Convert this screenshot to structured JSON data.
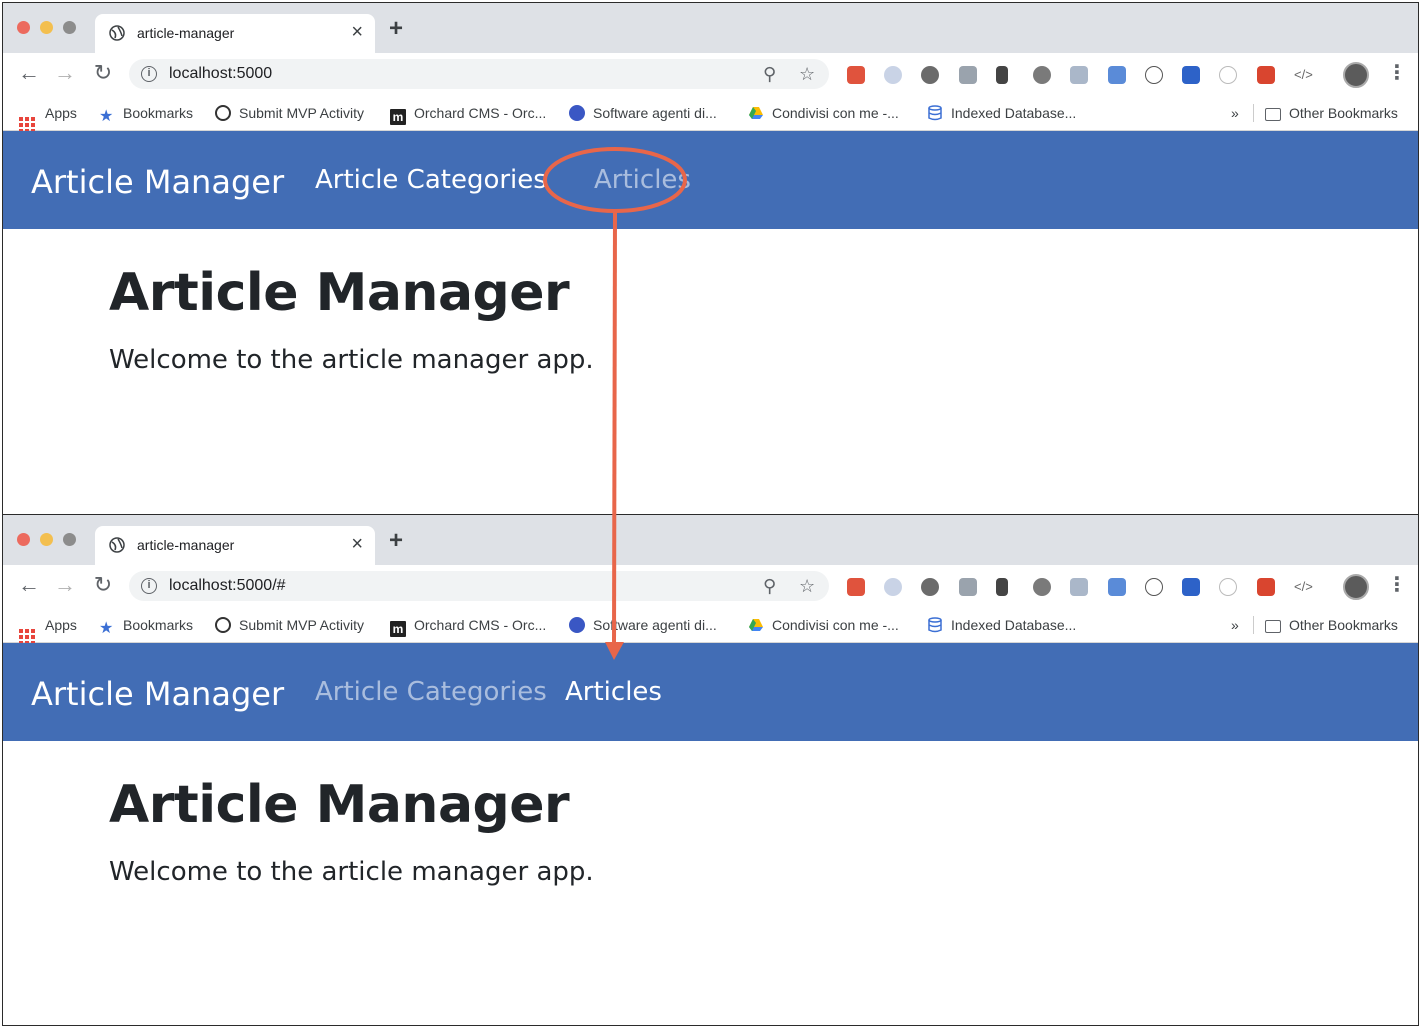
{
  "colors": {
    "navbar": "#426db5",
    "annotation": "#e8664a",
    "text_dark": "#212529",
    "chrome_tabstrip": "#dee1e6"
  },
  "bookmarks": [
    {
      "label": "Apps",
      "icon": "apps-grid-icon"
    },
    {
      "label": "Bookmarks",
      "icon": "star-icon"
    },
    {
      "label": "Submit MVP Activity",
      "icon": "globe-icon"
    },
    {
      "label": "Orchard CMS - Orc...",
      "icon": "orchard-m-icon"
    },
    {
      "label": "Software agenti di...",
      "icon": "agent-icon"
    },
    {
      "label": "Condivisi con me -...",
      "icon": "drive-icon"
    },
    {
      "label": "Indexed Database...",
      "icon": "database-icon"
    }
  ],
  "overflow_label": "»",
  "other_bookmarks": "Other Bookmarks",
  "windows": [
    {
      "tab_title": "article-manager",
      "tab_close": "×",
      "new_tab": "+",
      "url": "localhost:5000",
      "app": {
        "brand": "Article Manager",
        "nav": [
          {
            "label": "Article Categories",
            "active": true
          },
          {
            "label": "Articles",
            "active": false
          }
        ],
        "heading": "Article Manager",
        "welcome": "Welcome to the article manager app."
      }
    },
    {
      "tab_title": "article-manager",
      "tab_close": "×",
      "new_tab": "+",
      "url": "localhost:5000/#",
      "app": {
        "brand": "Article Manager",
        "nav": [
          {
            "label": "Article Categories",
            "active": false
          },
          {
            "label": "Articles",
            "active": true
          }
        ],
        "heading": "Article Manager",
        "welcome": "Welcome to the article manager app."
      }
    }
  ]
}
